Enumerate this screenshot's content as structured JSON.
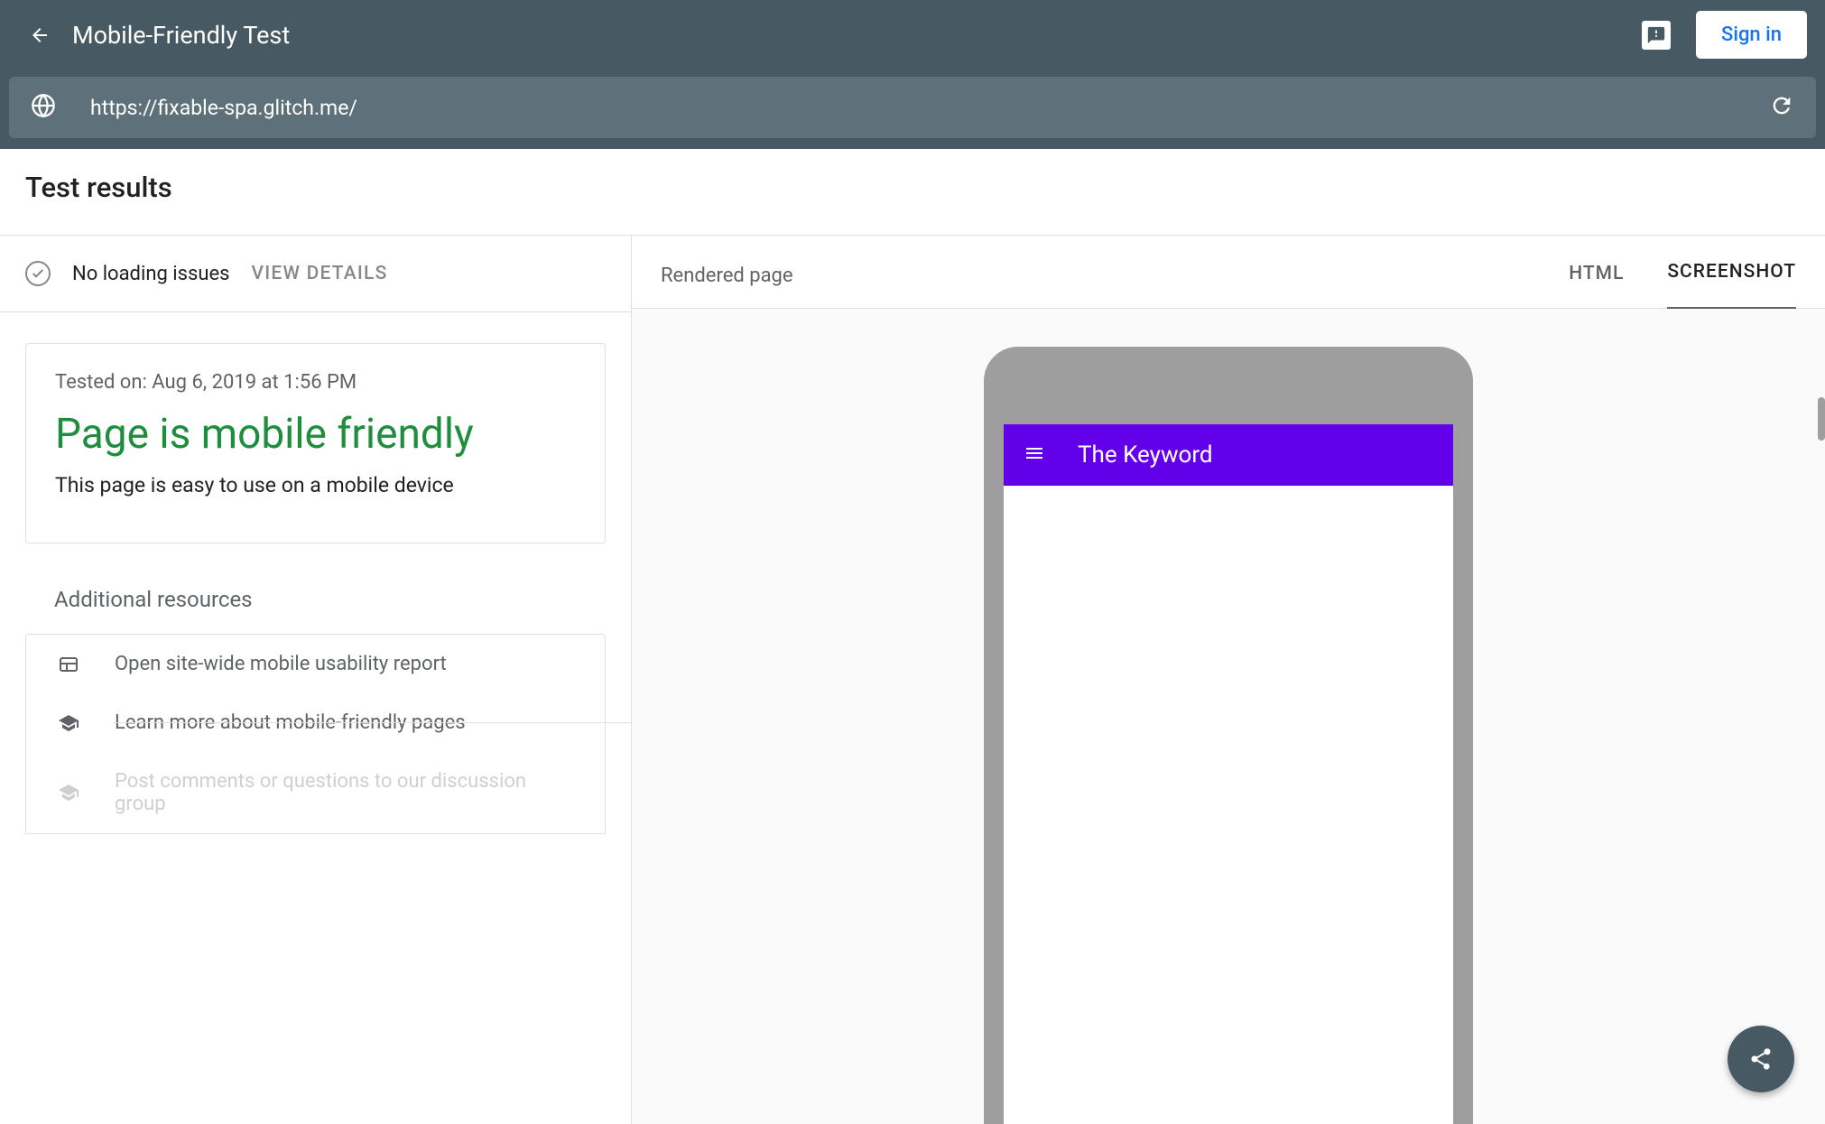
{
  "header": {
    "title": "Mobile-Friendly Test",
    "signin_label": "Sign in"
  },
  "urlbar": {
    "url": "https://fixable-spa.glitch.me/"
  },
  "results": {
    "heading": "Test results",
    "status_text": "No loading issues",
    "view_details_label": "VIEW DETAILS",
    "tested_on": "Tested on: Aug 6, 2019 at 1:56 PM",
    "headline": "Page is mobile friendly",
    "description": "This page is easy to use on a mobile device"
  },
  "resources": {
    "heading": "Additional resources",
    "items": [
      {
        "label": "Open site-wide mobile usability report"
      },
      {
        "label": "Learn more about mobile-friendly pages"
      },
      {
        "label": "Post comments or questions to our discussion group"
      }
    ]
  },
  "preview": {
    "label": "Rendered page",
    "tabs": {
      "html": "HTML",
      "screenshot": "SCREENSHOT"
    },
    "phone_title": "The Keyword"
  }
}
